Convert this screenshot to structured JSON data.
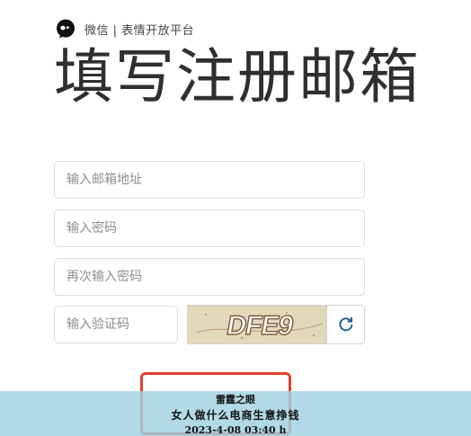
{
  "brand": {
    "text": "微信 | 表情开放平台",
    "logo_icon": "wechat-bubble-icon"
  },
  "page": {
    "title": "填写注册邮箱"
  },
  "form": {
    "email_placeholder": "输入邮箱地址",
    "password_placeholder": "输入密码",
    "confirm_password_placeholder": "再次输入密码",
    "captcha_placeholder": "输入验证码",
    "captcha_text": "DFE9",
    "refresh_icon": "refresh-icon"
  },
  "watermark": {
    "line1": "雷霆之眼",
    "line2": "女人做什么电商生意挣钱",
    "line3": "2023-4-08 03:40 h"
  },
  "colors": {
    "highlight_border": "#e0402e",
    "watermark_bg": "#a0d2e1"
  }
}
